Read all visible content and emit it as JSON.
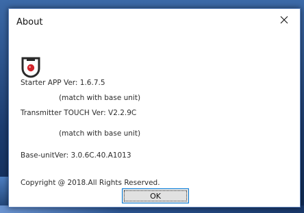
{
  "window": {
    "title": "About"
  },
  "about": {
    "starter_version": "Starter APP Ver: 1.6.7.5",
    "starter_match": "(match with base unit)",
    "transmitter_version": "Transmitter TOUCH Ver: V2.2.9C",
    "transmitter_match": "(match with base unit)",
    "base_unit_version": "Base-unitVer: 3.0.6C.40.A1013",
    "copyright": "Copyright @ 2018.All Rights Reserved."
  },
  "buttons": {
    "ok_label": "OK"
  },
  "icons": {
    "close": "close-icon",
    "logo": "app-logo-icon"
  },
  "colors": {
    "logo_red": "#d1232a",
    "logo_dark": "#2a2a2a",
    "focus_border": "#0078d7"
  }
}
